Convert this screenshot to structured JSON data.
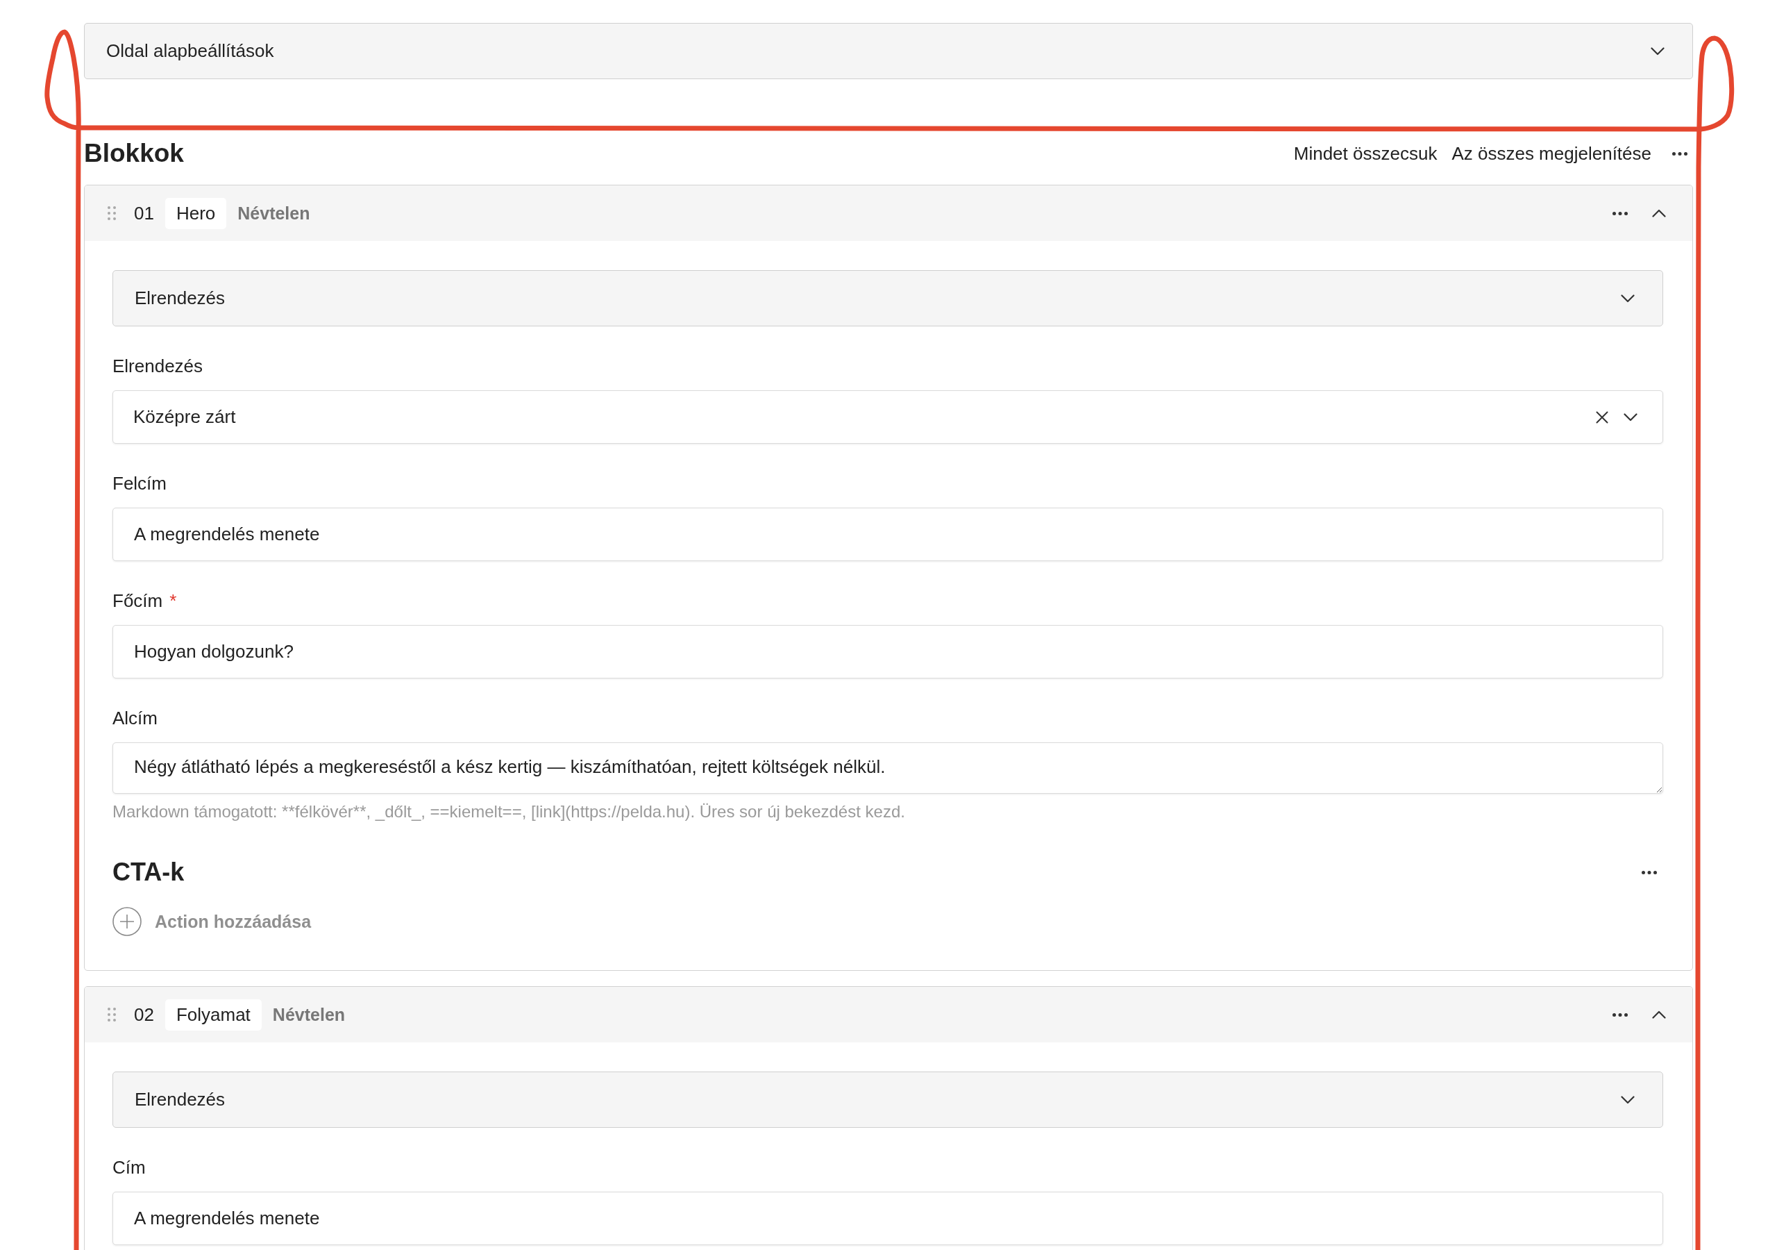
{
  "page_settings": {
    "title": "Oldal alapbeállítások",
    "expanded": false
  },
  "blocks_toolbar": {
    "title": "Blokkok",
    "actions": [
      "Mindet összecsuk",
      "Az összes megjelenítése"
    ]
  },
  "blocks": [
    {
      "number": "01",
      "type": "Hero",
      "name": "Névtelen",
      "expanded": true,
      "items": [
        {
          "kind": "group",
          "title": "Elrendezés",
          "expanded": false
        },
        {
          "kind": "select",
          "label": "Elrendezés",
          "value": "Középre zárt"
        },
        {
          "kind": "text",
          "label": "Felcím",
          "value": "A megrendelés menete"
        },
        {
          "kind": "text",
          "label": "Főcím",
          "required_mark": "*",
          "value": "Hogyan dolgozunk?"
        },
        {
          "kind": "textarea",
          "label": "Alcím",
          "value": "Négy átlátható lépés a megkereséstől a kész kertig — kiszámíthatóan, rejtett költségek nélkül.",
          "help": "Markdown támogatott: **félkövér**, _dőlt_, ==kiemelt==, [link](https://pelda.hu). Üres sor új bekezdést kezd."
        },
        {
          "kind": "list",
          "title": "CTA-k",
          "add_label": "Action hozzáadása"
        }
      ]
    },
    {
      "number": "02",
      "type": "Folyamat",
      "name": "Névtelen",
      "expanded": true,
      "items": [
        {
          "kind": "group",
          "title": "Elrendezés",
          "expanded": false
        },
        {
          "kind": "text",
          "label": "Cím",
          "value": "A megrendelés menete"
        }
      ]
    }
  ]
}
